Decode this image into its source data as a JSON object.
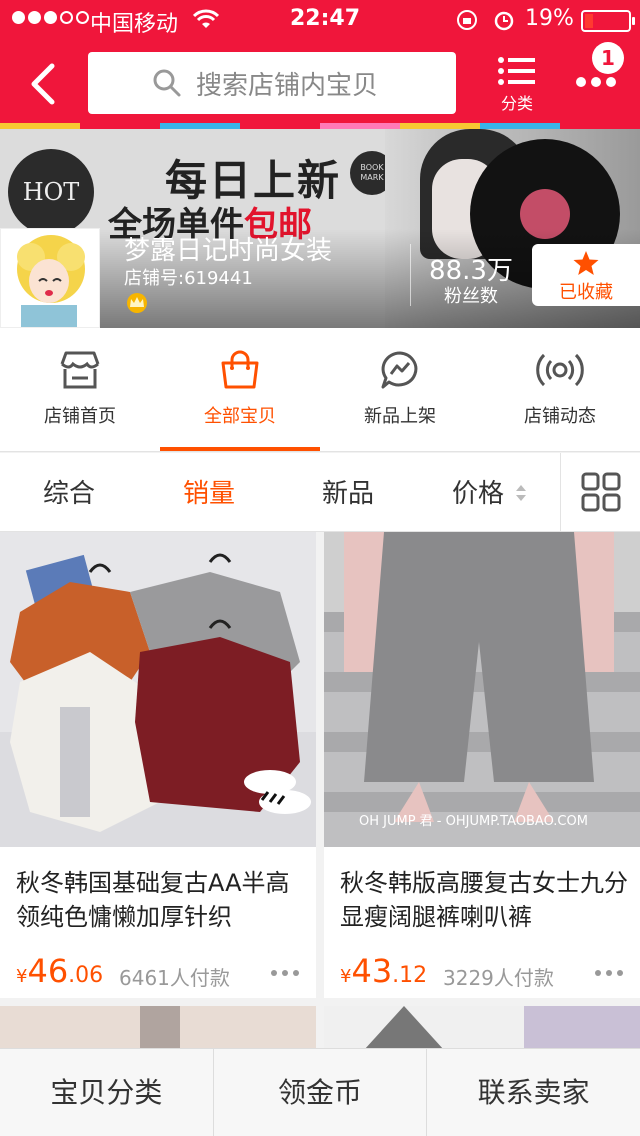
{
  "status_bar": {
    "carrier": "中国移动",
    "time": "22:47",
    "battery": "19%",
    "battery_level": 0.19
  },
  "header": {
    "search_placeholder": "搜索店铺内宝贝",
    "category_label": "分类",
    "notification_count": "1"
  },
  "banner": {
    "hot_badge": "HOT",
    "ad_line1": "每日上新",
    "ad_line2_prefix": "全场单件",
    "ad_line2_highlight": "包邮",
    "book_badge": "BOOK MARK"
  },
  "shop": {
    "name": "梦露日记时尚女装",
    "shop_id": "店铺号:619441",
    "fans_count": "88.3万",
    "fans_label": "粉丝数",
    "favorite_label": "已收藏"
  },
  "tabs": [
    {
      "label": "店铺首页",
      "icon": "store-icon",
      "active": false
    },
    {
      "label": "全部宝贝",
      "icon": "shopping-bag-icon",
      "active": true
    },
    {
      "label": "新品上架",
      "icon": "new-arrival-icon",
      "active": false
    },
    {
      "label": "店铺动态",
      "icon": "broadcast-icon",
      "active": false
    }
  ],
  "sort": {
    "overall": "综合",
    "sales": "销量",
    "new": "新品",
    "price": "价格",
    "active": "sales"
  },
  "products": [
    {
      "title": "秋冬韩国基础复古AA半高领纯色慵懒加厚针织",
      "currency": "¥",
      "price_int": "46",
      "price_dec": ".06",
      "sold": "6461人付款"
    },
    {
      "title": "秋冬韩版高腰复古女士九分显瘦阔腿裤喇叭裤",
      "currency": "¥",
      "price_int": "43",
      "price_dec": ".12",
      "sold": "3229人付款",
      "watermark": "OH JUMP 君 - OHJUMP.TAOBAO.COM"
    }
  ],
  "bottom_bar": {
    "categories": "宝贝分类",
    "coins": "领金币",
    "contact": "联系卖家"
  },
  "colors": {
    "brand_red": "#f0163b",
    "accent_orange": "#ff5000"
  }
}
